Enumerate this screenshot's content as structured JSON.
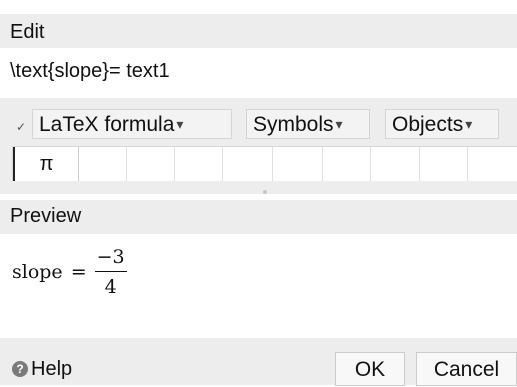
{
  "edit": {
    "header": "Edit",
    "value": "\\text{slope}= text1"
  },
  "toolbar": {
    "check_glyph": "✓",
    "latex_label": "LaTeX formula",
    "symbols_label": "Symbols",
    "objects_label": "Objects",
    "caret": "▾",
    "palette": [
      "π",
      "",
      "",
      "",
      "",
      "",
      "",
      "",
      "",
      "",
      ""
    ]
  },
  "preview": {
    "header": "Preview",
    "lhs": "slope",
    "equals": "=",
    "numerator": "−3",
    "denominator": "4"
  },
  "footer": {
    "help_icon": "?",
    "help_label": "Help",
    "ok_label": "OK",
    "cancel_label": "Cancel"
  }
}
